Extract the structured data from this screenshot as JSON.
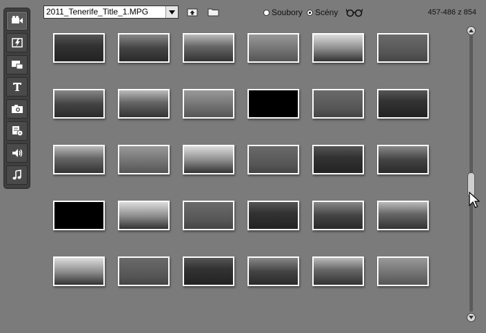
{
  "toolbar": {
    "tools": [
      {
        "name": "video-icon",
        "active": true
      },
      {
        "name": "transition-icon",
        "active": false
      },
      {
        "name": "picture-in-picture-icon",
        "active": false
      },
      {
        "name": "title-text-icon",
        "active": false,
        "glyph": "T"
      },
      {
        "name": "camera-icon",
        "active": false
      },
      {
        "name": "menu-disc-icon",
        "active": false
      },
      {
        "name": "sound-effects-icon",
        "active": false
      },
      {
        "name": "music-icon",
        "active": false
      }
    ]
  },
  "file_select": {
    "value": "2011_Tenerife_Title_1.MPG"
  },
  "view_mode": {
    "option_files": "Soubory",
    "option_scenes": "Scény",
    "selected": "scenes"
  },
  "range_label": "457-486 z 854",
  "colors": {
    "background": "#7b7b7b",
    "toolbar": "#3f3f3f",
    "thumb_border": "#ffffff"
  },
  "scenes": [
    "forest-trail",
    "forest-trees",
    "mountain-valley",
    "misty-ridge",
    "people-viewpoint",
    "foggy-railing",
    "dark-cliff-sunset",
    "coastal-path",
    "rocky-hills",
    "black-frame",
    "green-hills",
    "hill-slope",
    "cliff-edge",
    "cactus-plants",
    "shrub-valley",
    "sea-horizon",
    "coastal-mountain",
    "coastal-town",
    "black-frame",
    "tree-lined-path",
    "church-tower",
    "garden-trees",
    "garden-palms",
    "forest-canopy",
    "flower-bush",
    "green-trees",
    "flower-garden",
    "white-flowers",
    "old-building",
    "tree-avenue"
  ]
}
